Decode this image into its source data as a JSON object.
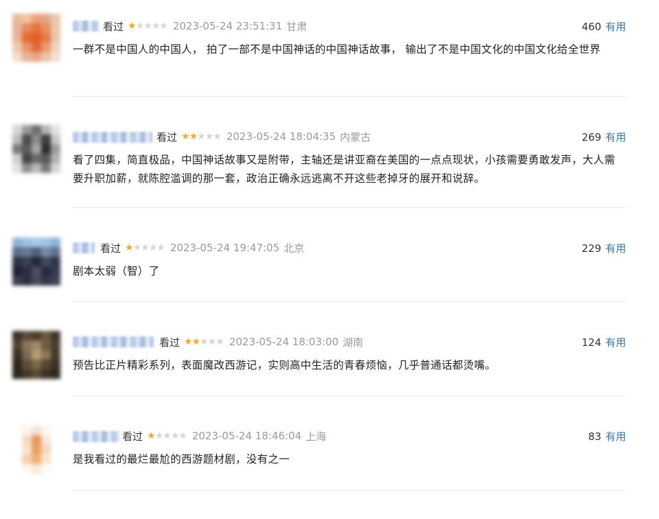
{
  "comments": [
    {
      "watched": "看过",
      "stars": 1,
      "time": "2023-05-24 23:51:31",
      "location": "甘肃",
      "votes": "460",
      "useful": "有用",
      "text": "一群不是中国人的中国人， 拍了一部不是中国神话的中国神话故事， 输出了不是中国文化的中国文化给全世界",
      "avatar": [
        "#e7b99a",
        "#f0c4a4",
        "#e8a07e",
        "#dfa987",
        "#e9c7aa",
        "#e7b19a",
        "#e48a5c",
        "#e6733c",
        "#e88f5f",
        "#ebc8ac",
        "#e9b49a",
        "#e56a2f",
        "#e35f22",
        "#e8794a",
        "#eac6a8",
        "#eec9b0",
        "#e8956b",
        "#e36b37",
        "#e99a6f",
        "#efd3bd",
        "#f1dcc8",
        "#e7b39a",
        "#e8a587",
        "#ebc2a6",
        "#f2e0d0"
      ]
    },
    {
      "watched": "看过",
      "stars": 2,
      "time": "2023-05-24 18:04:35",
      "location": "内蒙古",
      "votes": "269",
      "useful": "有用",
      "text": "看了四集，简直极品，中国神话故事又是附带，主轴还是讲亚裔在美国的一点点现状，小孩需要勇敢发声，大人需要升职加薪，就陈腔滥调的那一套，政治正确永远逃离不开这些老掉牙的展开和说辞。",
      "avatar": [
        "#d7d7d7",
        "#9a9a9a",
        "#6e6e6e",
        "#b5b5b5",
        "#e2e2e2",
        "#bdbdbd",
        "#4d4d4d",
        "#8c8c8c",
        "#3f3f3f",
        "#c9c9c9",
        "#7b7b7b",
        "#5c5c5c",
        "#a5a5a5",
        "#2f2f2f",
        "#9c9c9c",
        "#cfcfcf",
        "#454545",
        "#6a6a6a",
        "#5a5a5a",
        "#b1b1b1",
        "#e0e0e0",
        "#8e8e8e",
        "#b8b8b8",
        "#7a7a7a",
        "#d4d4d4"
      ]
    },
    {
      "watched": "看过",
      "stars": 1,
      "time": "2023-05-24 19:47:05",
      "location": "北京",
      "votes": "229",
      "useful": "有用",
      "text": "剧本太弱（智）了",
      "avatar": [
        "#8fb3d9",
        "#9cc0e3",
        "#a8c8e8",
        "#9fc2e4",
        "#8db1d8",
        "#5f6e86",
        "#6a7891",
        "#53627b",
        "#7888a1",
        "#65738c",
        "#2e3348",
        "#3c4157",
        "#23283b",
        "#44495f",
        "#30364a",
        "#1f2333",
        "#2b2f42",
        "#4a4e63",
        "#262a3b",
        "#353a4e",
        "#3a3d4f",
        "#2c2f40",
        "#474a5c",
        "#31344a",
        "#3d4155"
      ]
    },
    {
      "watched": "看过",
      "stars": 2,
      "time": "2023-05-24 18:03:00",
      "location": "湖南",
      "votes": "124",
      "useful": "有用",
      "text": "预告比正片精彩系列，表面魔改西游记，实则高中生活的青春烦恼，几乎普通话都烫嘴。",
      "avatar": [
        "#3b3227",
        "#5a4a36",
        "#4a3d2d",
        "#6b5940",
        "#3f3428",
        "#52432f",
        "#8a7658",
        "#a08a66",
        "#6e5b41",
        "#4b3e2d",
        "#3a3024",
        "#7c6a4f",
        "#b39d78",
        "#8d7857",
        "#463a2b",
        "#2f281f",
        "#5d4e39",
        "#7a6749",
        "#564733",
        "#3c3226",
        "#2a241c",
        "#43382a",
        "#5a4b37",
        "#3b3125",
        "#2f281e"
      ]
    },
    {
      "watched": "看过",
      "stars": 1,
      "time": "2023-05-24 18:46:04",
      "location": "上海",
      "votes": "83",
      "useful": "有用",
      "text": "是我看过的最烂最尬的西游题材剧，没有之一",
      "avatar": [
        "#ffffff",
        "#fbf3ec",
        "#f6e2d2",
        "#fdf7f2",
        "#ffffff",
        "#ffffff",
        "#f4dcc8",
        "#e89a5c",
        "#f7e6d8",
        "#ffffff",
        "#ffffff",
        "#f7e2cf",
        "#eea05c",
        "#f5d7bd",
        "#ffffff",
        "#ffffff",
        "#f4cfae",
        "#f3b073",
        "#f8e4d2",
        "#ffffff",
        "#ffffff",
        "#fdf6f0",
        "#f8e8da",
        "#fefaf6",
        "#ffffff"
      ]
    }
  ]
}
